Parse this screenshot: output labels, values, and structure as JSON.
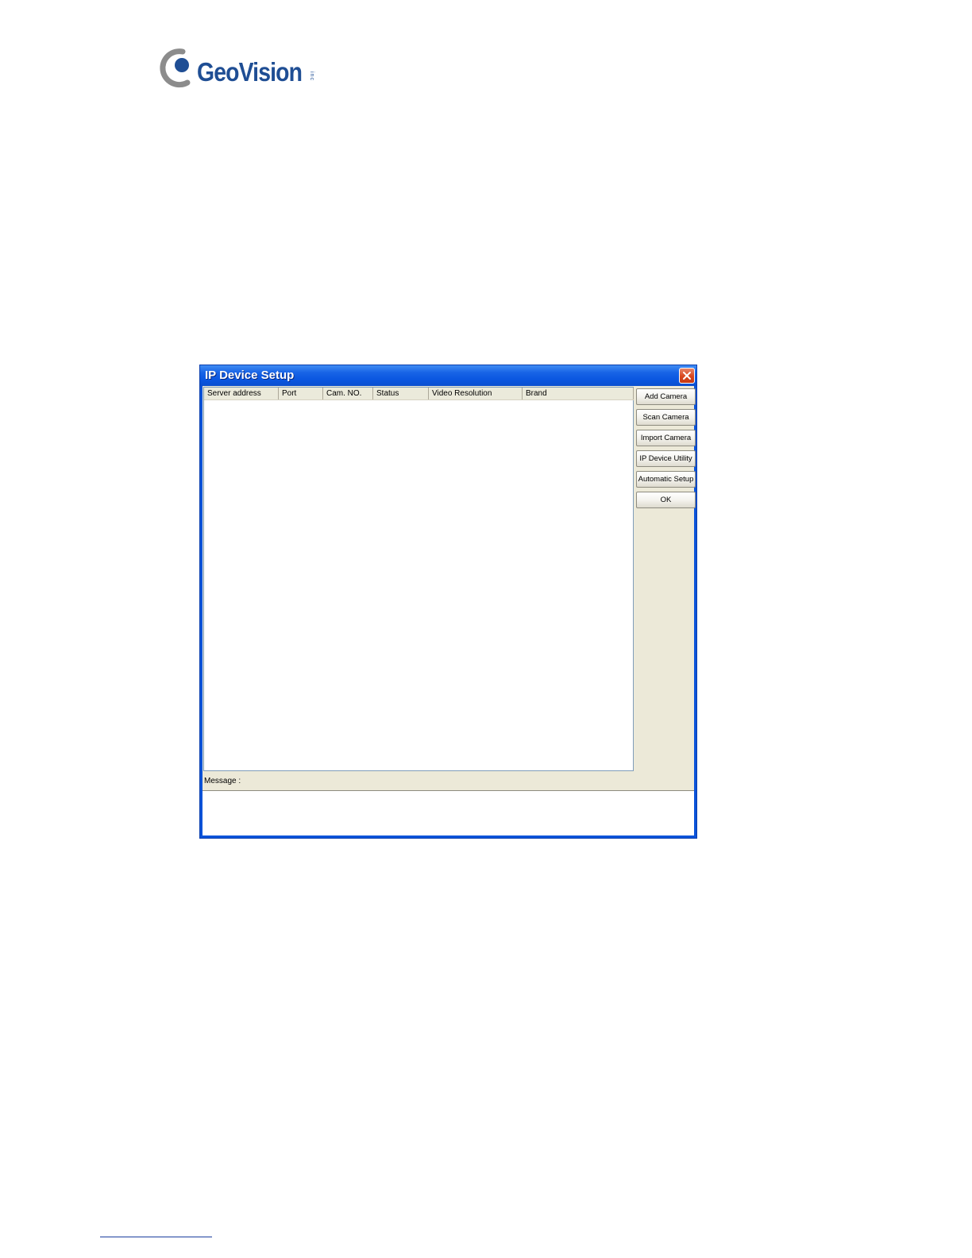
{
  "logo": {
    "name": "GeoVision",
    "suffix": "inc",
    "brand_color": "#1f4e94",
    "accent_color": "#808080"
  },
  "window": {
    "title": "IP Device Setup",
    "close_icon": "close-icon",
    "titlebar_color": "#0a56e0",
    "face_color": "#ece9d8"
  },
  "table": {
    "columns": [
      "Server address",
      "Port",
      "Cam. NO.",
      "Status",
      "Video Resolution",
      "Brand"
    ],
    "rows": []
  },
  "buttons": {
    "add_camera": "Add Camera",
    "scan_camera": "Scan Camera",
    "import_camera": "Import Camera",
    "ip_device_utility": "IP Device Utility",
    "automatic_setup": "Automatic Setup",
    "ok": "OK"
  },
  "message": {
    "label": "Message :",
    "value": ""
  }
}
